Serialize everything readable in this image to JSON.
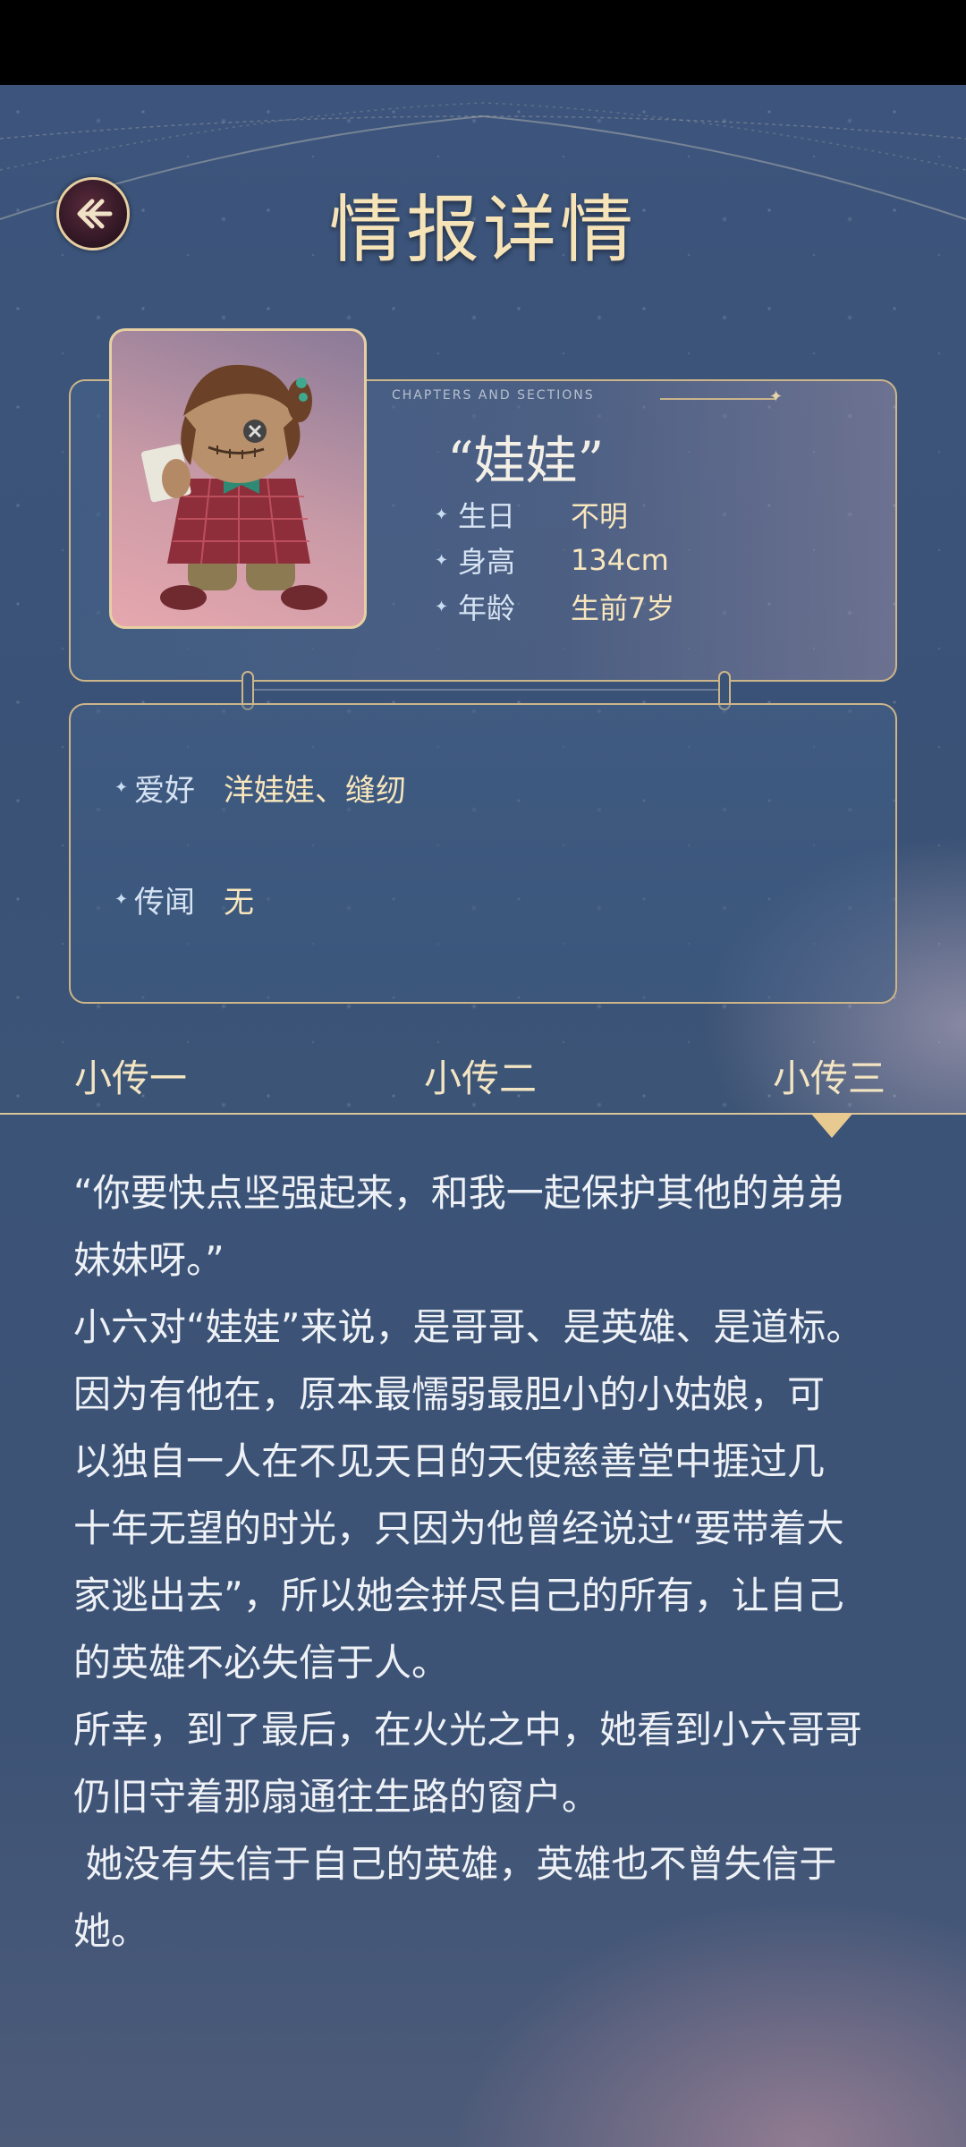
{
  "header": {
    "title": "情报详情"
  },
  "character": {
    "subtitle": "CHAPTERS AND SECTIONS",
    "name": "“娃娃”",
    "attributes": [
      {
        "label": "生日",
        "value": "不明"
      },
      {
        "label": "身高",
        "value": "134cm"
      },
      {
        "label": "年龄",
        "value": "生前7岁"
      }
    ],
    "details": [
      {
        "label": "爱好",
        "value": "洋娃娃、缝纫"
      },
      {
        "label": "传闻",
        "value": "无"
      }
    ]
  },
  "tabs": [
    {
      "label": "小传一",
      "active": false
    },
    {
      "label": "小传二",
      "active": false
    },
    {
      "label": "小传三",
      "active": true
    }
  ],
  "story": {
    "text": "“你要快点坚强起来，和我一起保护其他的弟弟\n妹妹呀。”\n小六对“娃娃”来说，是哥哥、是英雄、是道标。\n因为有他在，原本最懦弱最胆小的小姑娘，可\n以独自一人在不见天日的天使慈善堂中捱过几\n十年无望的时光，只因为他曾经说过“要带着大\n家逃出去”，所以她会拼尽自己的所有，让自己\n的英雄不必失信于人。\n所幸，到了最后，在火光之中，她看到小六哥哥\n仍旧守着那扇通往生路的窗户。\n 她没有失信于自己的英雄，英雄也不曾失信于\n她。"
  },
  "colors": {
    "gold": "#e8cfa1",
    "title": "#f6e3b7",
    "panel": "#3b5377"
  },
  "icons": {
    "back": "back-arrow-icon",
    "bullet": "sparkle-star-icon"
  }
}
